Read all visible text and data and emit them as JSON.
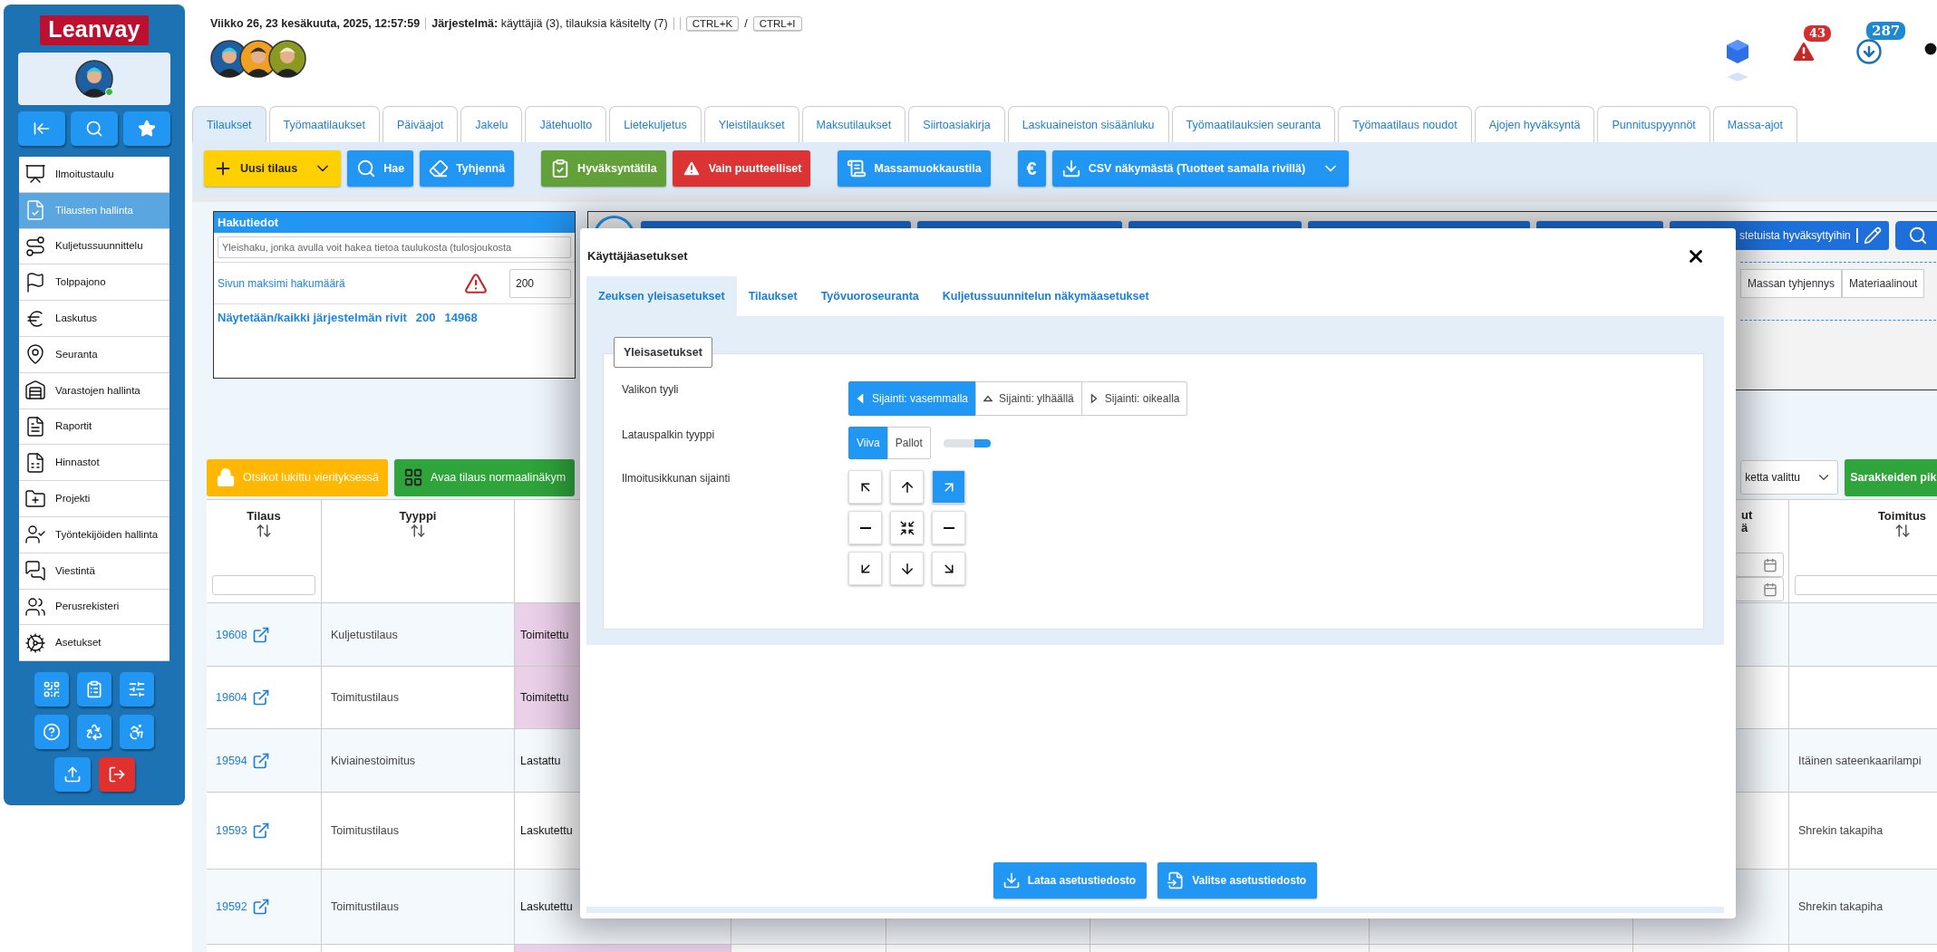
{
  "sidebar": {
    "logo": "Leanvay",
    "user": {
      "online": true
    },
    "menu": [
      {
        "label": "Ilmoitustaulu",
        "selected": false
      },
      {
        "label": "Tilausten hallinta",
        "selected": true
      },
      {
        "label": "Kuljetussuunnittelu",
        "selected": false
      },
      {
        "label": "Tolppajono",
        "selected": false
      },
      {
        "label": "Laskutus",
        "selected": false
      },
      {
        "label": "Seuranta",
        "selected": false
      },
      {
        "label": "Varastojen hallinta",
        "selected": false
      },
      {
        "label": "Raportit",
        "selected": false
      },
      {
        "label": "Hinnastot",
        "selected": false
      },
      {
        "label": "Projekti",
        "selected": false
      },
      {
        "label": "Työntekijöiden hallinta",
        "selected": false
      },
      {
        "label": "Viestintä",
        "selected": false
      },
      {
        "label": "Perusrekisteri",
        "selected": false
      },
      {
        "label": "Asetukset",
        "selected": false
      }
    ]
  },
  "header": {
    "datetime": "Viikko 26, 23 kesäkuuta, 2025, 12:57:59",
    "system": "**Järjestelmä:** käyttäjiä (3), tilauksia käsitelty (7)",
    "shortcuts": [
      "CTRL+K",
      "CTRL+I"
    ],
    "shortcut_separator": "/",
    "alerts": "43",
    "messages": "287"
  },
  "tabs": [
    {
      "label": "Tilaukset",
      "selected": true
    },
    {
      "label": "Työmaatilaukset",
      "selected": false
    },
    {
      "label": "Päiväajot",
      "selected": false
    },
    {
      "label": "Jakelu",
      "selected": false
    },
    {
      "label": "Jätehuolto",
      "selected": false
    },
    {
      "label": "Lietekuljetus",
      "selected": false
    },
    {
      "label": "Yleistilaukset",
      "selected": false
    },
    {
      "label": "Maksutilaukset",
      "selected": false
    },
    {
      "label": "Siirtoasiakirja",
      "selected": false
    },
    {
      "label": "Laskuaineiston sisäänluku",
      "selected": false
    },
    {
      "label": "Työmaatilauksien seuranta",
      "selected": false
    },
    {
      "label": "Työmaatilaus noudot",
      "selected": false
    },
    {
      "label": "Ajojen hyväksyntä",
      "selected": false
    },
    {
      "label": "Punnituspyynnöt",
      "selected": false
    },
    {
      "label": "Massa-ajot",
      "selected": false
    }
  ],
  "toolbar": [
    [
      {
        "label": "Uusi tilaus",
        "kind": "warning",
        "has_menu": true
      },
      {
        "label": "Hae",
        "kind": "primary",
        "has_menu": false
      },
      {
        "label": "Tyhjennä",
        "kind": "primary",
        "has_menu": false
      }
    ],
    [
      {
        "label": "Hyväksyntätila",
        "kind": "success",
        "has_menu": false
      },
      {
        "label": "Vain puutteelliset",
        "kind": "danger",
        "has_menu": false
      }
    ],
    [
      {
        "label": "Massamuokkaustila",
        "kind": "primary",
        "has_menu": false
      }
    ],
    [
      {
        "label": "€",
        "kind": "primary",
        "has_menu": false
      },
      {
        "label": "CSV näkymästä (Tuotteet samalla rivillä)",
        "kind": "primary",
        "has_menu": true
      }
    ]
  ],
  "search_panel": {
    "title": "Hakutiedot",
    "search": {
      "placeholder": "Yleishaku, jonka avulla voit hakea tietoa taulukosta (tulosjoukosta"
    },
    "max_label": "Sivun maksimi hakumäärä",
    "max_value": "200",
    "rows_label": "Näytetään/kaikki järjestelmän rivit",
    "rows_shown": "200",
    "rows_total": "14968"
  },
  "filter_panel": {
    "approve_button": "stetuista hyväksyttyihin",
    "columns": [
      "Massan tyhjennys",
      "Materiaalinout"
    ]
  },
  "table_toolbar": {
    "lock_button": "Otsikot lukittu vierityksessä",
    "open_button": "Avaa tilaus normaalinäkym",
    "select": "ketta valittu",
    "columns_button": "Sarakkeiden pik"
  },
  "table": {
    "columns": {
      "tilaus": "Tilaus",
      "tyyppi": "Tyyppi",
      "column_8": [
        "ut",
        "ä"
      ],
      "toimitus": "Toimitus"
    },
    "rows": [
      {
        "tilaus": "19608",
        "tyyppi": "Kuljetustilaus",
        "column_3": "Toimitettu",
        "highlighted": true
      },
      {
        "tilaus": "19604",
        "tyyppi": "Toimitustilaus",
        "column_3": "Toimitettu",
        "highlighted": true
      },
      {
        "tilaus": "19594",
        "tyyppi": "Kiviainestoimitus",
        "column_3": "Lastattu",
        "highlighted": false,
        "toimitus": "Itäinen sateenkaarilampi"
      },
      {
        "tilaus": "19593",
        "tyyppi": "Toimitustilaus",
        "column_3": "Laskutettu",
        "highlighted": false,
        "toimitus": "Shrekin takapiha"
      },
      {
        "tilaus": "19592",
        "tyyppi": "Toimitustilaus",
        "column_3": "Laskutettu",
        "highlighted": false,
        "toimitus": "Shrekin takapiha"
      },
      {
        "highlighted": true
      }
    ]
  },
  "modal": {
    "title": "Käyttäjäasetukset",
    "tabs": [
      {
        "label": "Zeuksen yleisasetukset",
        "selected": true
      },
      {
        "label": "Tilaukset",
        "selected": false
      },
      {
        "label": "Työvuoroseuranta",
        "selected": false
      },
      {
        "label": "Kuljetussuunnitelun näkymäasetukset",
        "selected": false
      }
    ],
    "section": "Yleisasetukset",
    "settings": [
      {
        "kind": "segmented",
        "label": "Valikon tyyli",
        "options": [
          {
            "label": "Sijainti: vasemmalla",
            "selected": true
          },
          {
            "label": "Sijainti: ylhäällä",
            "selected": false
          },
          {
            "label": "Sijainti: oikealla",
            "selected": false
          }
        ]
      },
      {
        "kind": "loader",
        "label": "Latauspalkin tyyppi",
        "options": [
          {
            "label": "Viiva",
            "selected": true
          },
          {
            "label": "Pallot",
            "selected": false
          }
        ],
        "level": 0.35
      },
      {
        "kind": "position",
        "label": "Ilmoitusikkunan sijainti",
        "positions": [
          {
            "selected": false
          },
          {
            "selected": false
          },
          {
            "selected": true
          },
          {
            "selected": false
          },
          {
            "selected": false
          },
          {
            "selected": false
          },
          {
            "selected": false
          },
          {
            "selected": false
          },
          {
            "selected": false
          }
        ]
      }
    ],
    "buttons": [
      "Lataa asetustiedosto",
      "Valitse asetustiedosto"
    ]
  }
}
